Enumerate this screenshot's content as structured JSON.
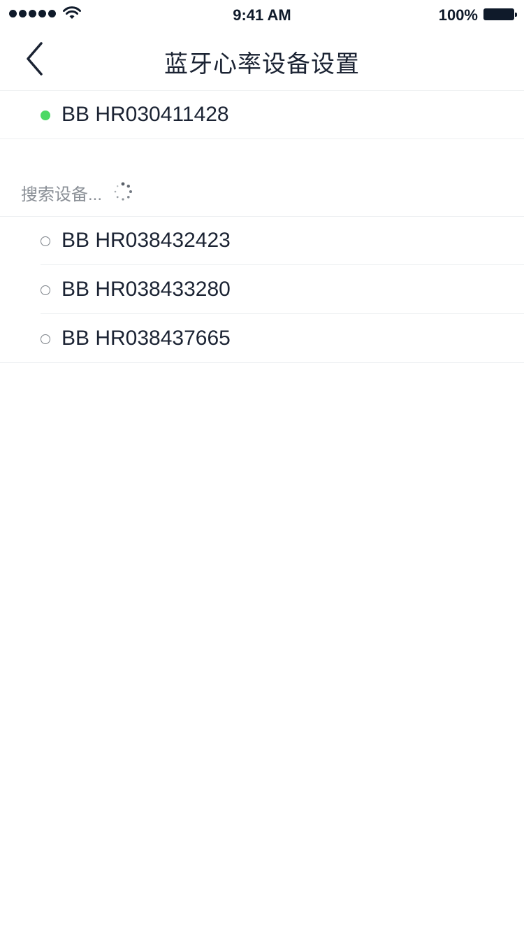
{
  "status_bar": {
    "time": "9:41 AM",
    "battery_percent": "100%",
    "signal_bars": 5,
    "icons": [
      "signal-dots-icon",
      "wifi-icon",
      "battery-icon"
    ]
  },
  "nav": {
    "back_icon": "chevron-left-icon",
    "title": "蓝牙心率设备设置"
  },
  "connected_device": {
    "name": "BB HR030411428",
    "status_color": "#4cd964"
  },
  "search": {
    "label": "搜索设备...",
    "icon": "loading-spinner-icon"
  },
  "found_devices": [
    {
      "name": "BB HR038432423"
    },
    {
      "name": "BB HR038433280"
    },
    {
      "name": "BB HR038437665"
    }
  ]
}
